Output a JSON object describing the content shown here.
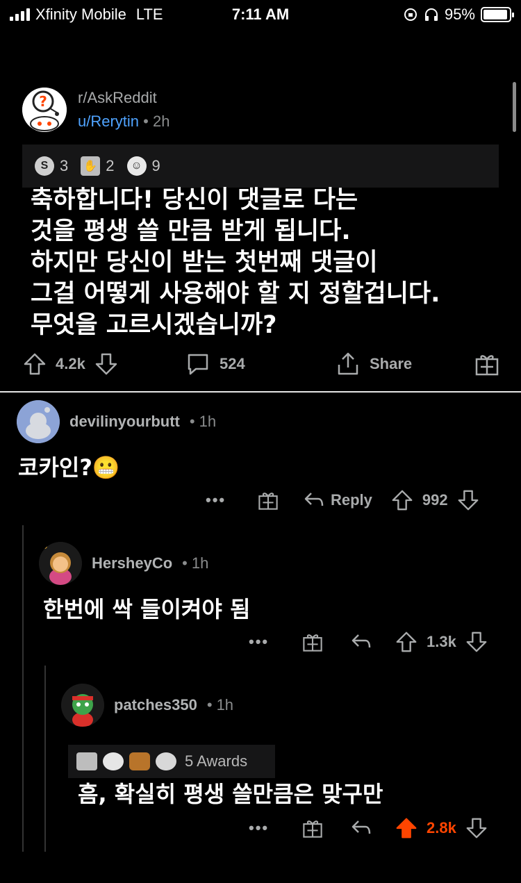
{
  "status_bar": {
    "carrier": "Xfinity Mobile",
    "network": "LTE",
    "time": "7:11 AM",
    "battery": "95%"
  },
  "post": {
    "subreddit": "r/AskReddit",
    "username": "u/Rerytin",
    "separator": "•",
    "age": "2h",
    "awards": [
      {
        "icon": "silver-award-icon",
        "count": "3"
      },
      {
        "icon": "helpful-award-icon",
        "count": "2"
      },
      {
        "icon": "wholesome-award-icon",
        "count": "9"
      }
    ],
    "body_lines": [
      "축하합니다! 당신이 댓글로 다는",
      "것을 평생 쓸 만큼 받게 됩니다.",
      "하지만 당신이 받는 첫번째 댓글이",
      "그걸 어떻게 사용해야 할 지 정할겁니다.",
      "무엇을 고르시겠습니까?"
    ],
    "score": "4.2k",
    "comments": "524",
    "share_label": "Share"
  },
  "comments": [
    {
      "username": "devilinyourbutt",
      "age": "1h",
      "body": "코카인?😬",
      "reply_label": "Reply",
      "score": "992"
    },
    {
      "username": "HersheyCo",
      "age": "1h",
      "body": "한번에 싹 들이켜야 됨",
      "score": "1.3k"
    },
    {
      "username": "patches350",
      "age": "1h",
      "awards_label": "5 Awards",
      "body": "흠, 확실히 평생 쓸만큼은 맞구만",
      "score": "2.8k"
    }
  ],
  "colors": {
    "background": "#000000",
    "text": "#ffffff",
    "muted": "#a9abac",
    "link": "#4fa3ff",
    "upvote": "#ff4500"
  }
}
